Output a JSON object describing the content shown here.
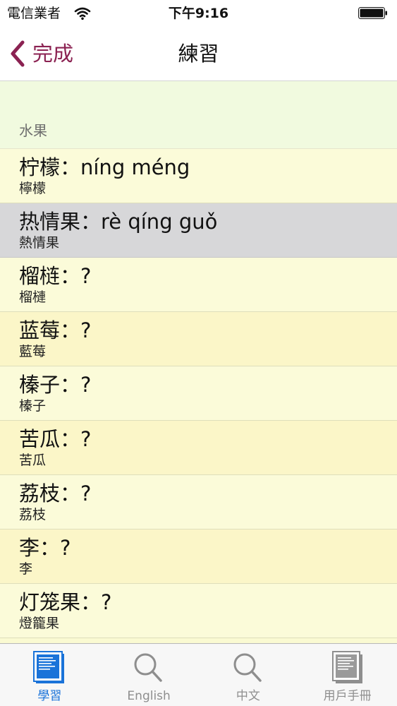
{
  "status_bar": {
    "carrier": "電信業者",
    "time": "下午9:16"
  },
  "nav": {
    "back_label": "完成",
    "title": "練習"
  },
  "section": {
    "label": "水果"
  },
  "rows": [
    {
      "main": "柠檬：níng  méng",
      "sub": "檸檬",
      "state": "plain"
    },
    {
      "main": "热情果：rè  qíng  guǒ",
      "sub": "熱情果",
      "state": "selected"
    },
    {
      "main": "榴梿：?",
      "sub": "榴槤",
      "state": "plain"
    },
    {
      "main": "蓝莓：?",
      "sub": "藍莓",
      "state": "alt"
    },
    {
      "main": "榛子：?",
      "sub": "榛子",
      "state": "plain"
    },
    {
      "main": "苦瓜：?",
      "sub": "苦瓜",
      "state": "alt"
    },
    {
      "main": "荔枝：?",
      "sub": "荔枝",
      "state": "plain"
    },
    {
      "main": "李：?",
      "sub": "李",
      "state": "alt"
    },
    {
      "main": "灯笼果：?",
      "sub": "燈籠果",
      "state": "plain"
    }
  ],
  "tabs": [
    {
      "label": "學習",
      "icon": "study-document-icon",
      "active": true
    },
    {
      "label": "English",
      "icon": "search-icon",
      "active": false
    },
    {
      "label": "中文",
      "icon": "search-icon",
      "active": false
    },
    {
      "label": "用戶手冊",
      "icon": "manual-document-icon",
      "active": false
    }
  ],
  "colors": {
    "accent": "#8b2252",
    "tab_active": "#1a73d9",
    "tab_inactive": "#8e8e8e"
  }
}
